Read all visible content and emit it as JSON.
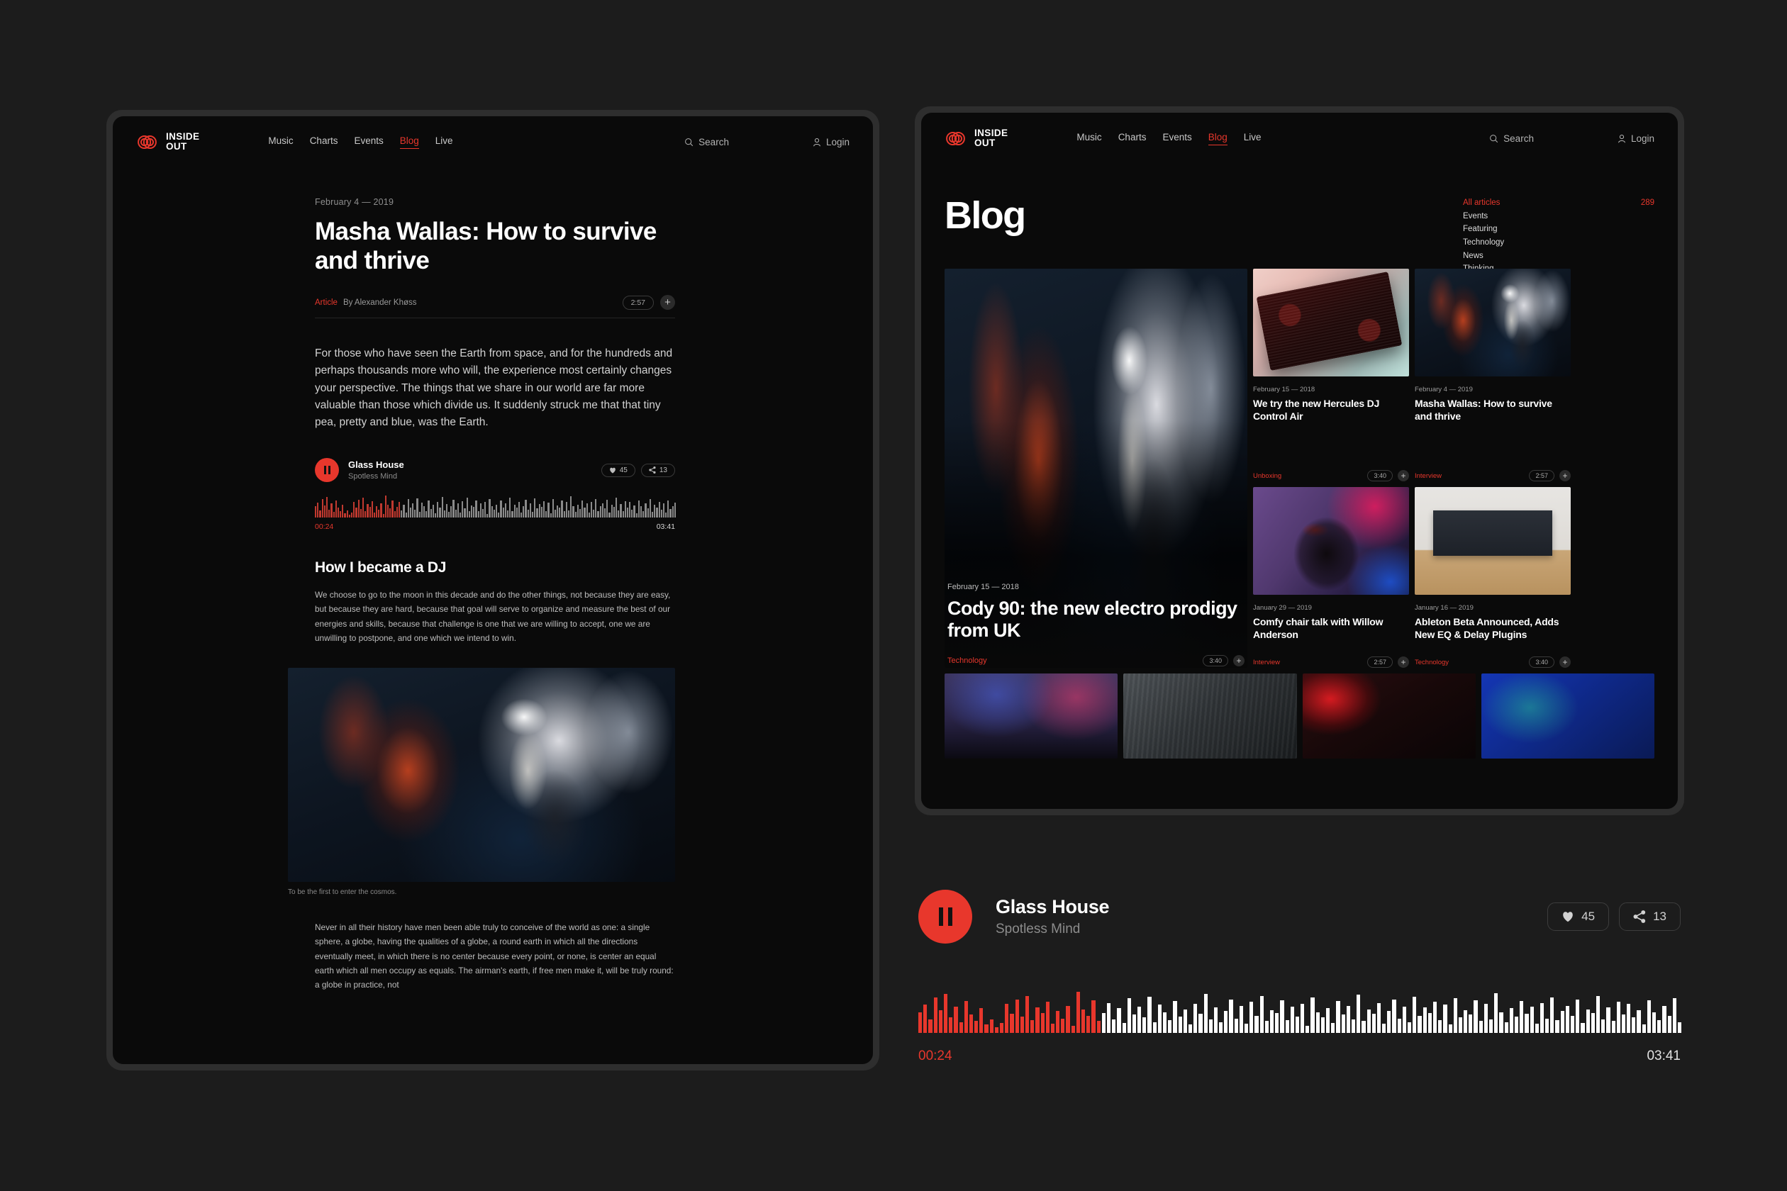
{
  "brand": {
    "line1": "INSIDE",
    "line2": "OUT",
    "mark_icon": "inside-out-logo-icon",
    "color": "#e8372c"
  },
  "nav": {
    "links": [
      {
        "label": "Music",
        "active": false
      },
      {
        "label": "Charts",
        "active": false
      },
      {
        "label": "Events",
        "active": false
      },
      {
        "label": "Blog",
        "active": true
      },
      {
        "label": "Live",
        "active": false
      }
    ],
    "search_label": "Search",
    "search_icon": "search-icon",
    "login_label": "Login",
    "login_icon": "user-icon"
  },
  "article": {
    "date": "February 4 — 2019",
    "title": "Masha Wallas: How to survive and thrive",
    "tag": "Article",
    "byline": "By Alexander Khøss",
    "duration": "2:57",
    "add_icon": "plus-icon",
    "lead": "For those who have seen the Earth from space, and for the hundreds and perhaps thousands more who will, the experience most certainly changes your perspective. The things that we share in our world are far more valuable than those which divide us. It suddenly struck me that that tiny pea, pretty and blue, was the Earth.",
    "heading2": "How I became a DJ",
    "paragraph2": "We choose to go to the moon in this decade and do the other things, not because they are easy, but because they are hard, because that goal will serve to organize and measure the best of our energies and skills, because that challenge is one that we are willing to accept, one we are unwilling to postpone, and one which we intend to win.",
    "figure_caption": "To be the first to enter the cosmos.",
    "figure_image": "dj-woman-headphones-photo",
    "paragraph3": "Never in all their history have men been able truly to conceive of the world as one: a single sphere, a globe, having the qualities of a globe, a round earth in which all the directions eventually meet, in which there is no center because every point, or none, is center an equal earth which all men occupy as equals. The airman's earth, if free men make it, will be truly round: a globe in practice, not"
  },
  "inline_player": {
    "play_icon": "pause-icon",
    "title": "Glass House",
    "subtitle": "Spotless Mind",
    "like_icon": "heart-icon",
    "likes": "45",
    "share_icon": "share-icon",
    "shares": "13",
    "current_time": "00:24",
    "total_time": "03:41",
    "progress_percent": 24,
    "played_color": "#c0392f",
    "remaining_color": "#8a8a8a"
  },
  "blog": {
    "title": "Blog",
    "categories": [
      {
        "name": "All articles",
        "count": "289",
        "active": true
      },
      {
        "name": "Events",
        "count": "",
        "active": false
      },
      {
        "name": "Featuring",
        "count": "",
        "active": false
      },
      {
        "name": "Technology",
        "count": "",
        "active": false
      },
      {
        "name": "News",
        "count": "",
        "active": false
      },
      {
        "name": "Thinking",
        "count": "",
        "active": false
      }
    ],
    "feature": {
      "date": "February 15 — 2018",
      "title": "Cody 90: the new electro prodigy from UK",
      "tag": "Technology",
      "duration": "3:40",
      "add_icon": "plus-icon",
      "image": "dj-performer-stage-photo"
    },
    "cards": [
      {
        "date": "February 15 — 2018",
        "title": "We try the new Hercules DJ Control Air",
        "tag": "Unboxing",
        "duration": "3:40",
        "add_icon": "plus-icon",
        "image": "dj-controller-photo"
      },
      {
        "date": "February 4 — 2019",
        "title": "Masha Wallas: How to survive and thrive",
        "tag": "Interview",
        "duration": "2:57",
        "add_icon": "plus-icon",
        "image": "dj-woman-headphones-photo"
      },
      {
        "date": "January 29 — 2019",
        "title": "Comfy chair talk with Willow Anderson",
        "tag": "Interview",
        "duration": "2:57",
        "add_icon": "plus-icon",
        "image": "neon-portrait-photo"
      },
      {
        "date": "January 16 — 2019",
        "title": "Ableton Beta Announced, Adds New EQ & Delay Plugins",
        "tag": "Technology",
        "duration": "3:40",
        "add_icon": "plus-icon",
        "image": "home-studio-desk-photo"
      }
    ],
    "strip": [
      {
        "image": "concert-crowd-photo"
      },
      {
        "image": "mixing-console-photo"
      },
      {
        "image": "red-sign-club-photo"
      },
      {
        "image": "blue-dj-booth-photo"
      }
    ]
  },
  "big_player": {
    "play_icon": "pause-icon",
    "title": "Glass House",
    "subtitle": "Spotless Mind",
    "like_icon": "heart-icon",
    "likes": "45",
    "share_icon": "share-icon",
    "shares": "13",
    "current_time": "00:24",
    "total_time": "03:41",
    "progress_percent": 24,
    "played_color": "#e8372c",
    "remaining_color": "#ffffff"
  },
  "waveform": {
    "bars": [
      46,
      62,
      30,
      78,
      50,
      86,
      34,
      58,
      24,
      70,
      40,
      26,
      54,
      18,
      30,
      12,
      22,
      64,
      42,
      74,
      36,
      82,
      28,
      56,
      44,
      68,
      20,
      48,
      32,
      60,
      16,
      90,
      52,
      38,
      72,
      26,
      44,
      66,
      30,
      54,
      22,
      76,
      40,
      58,
      34,
      80,
      24,
      62,
      46,
      28,
      70,
      36,
      52,
      18,
      64,
      42,
      86,
      30,
      56,
      24,
      48,
      74,
      32,
      60,
      20,
      68,
      38,
      82,
      26,
      50,
      44,
      72,
      28,
      58,
      36,
      64,
      16,
      78,
      46,
      34,
      54,
      22,
      70,
      40,
      60,
      30,
      84,
      26,
      52,
      42,
      66,
      20,
      48,
      74,
      32,
      58,
      24,
      80,
      38,
      56,
      44,
      68,
      28,
      62,
      18,
      76,
      34,
      50,
      40,
      72,
      26,
      64,
      30,
      88,
      46,
      24,
      54,
      36,
      70,
      42,
      58,
      20,
      66,
      32,
      78,
      28,
      48,
      60,
      38,
      74,
      22,
      52,
      44,
      82,
      30,
      56,
      26,
      68,
      40,
      64,
      34,
      50,
      18,
      72,
      46,
      28,
      60,
      38,
      76,
      24,
      54,
      42,
      66,
      32,
      58,
      20,
      70,
      36,
      48,
      62,
      28,
      80,
      44,
      26,
      52,
      34,
      68,
      40,
      74,
      22,
      56,
      30,
      64,
      18,
      84,
      46,
      38,
      60,
      24,
      50,
      42,
      72,
      28,
      66,
      34,
      54,
      20,
      78,
      40,
      58,
      32,
      62,
      26,
      70,
      44,
      48,
      36,
      82,
      22,
      56,
      30,
      68,
      38,
      52,
      46,
      74,
      24,
      60,
      40,
      64,
      28,
      50,
      34,
      76,
      42,
      58,
      20,
      66,
      32,
      54,
      26,
      70,
      44,
      38,
      62,
      48,
      24,
      72,
      30,
      56,
      36,
      80,
      22,
      52,
      40,
      64,
      28,
      46,
      60,
      34,
      68,
      42,
      26,
      74,
      32,
      50,
      58,
      20,
      56,
      38,
      66,
      24,
      44,
      70,
      30,
      52,
      36,
      62,
      28,
      48,
      40,
      58,
      22,
      34,
      54,
      26,
      42,
      30,
      20,
      16
    ]
  }
}
